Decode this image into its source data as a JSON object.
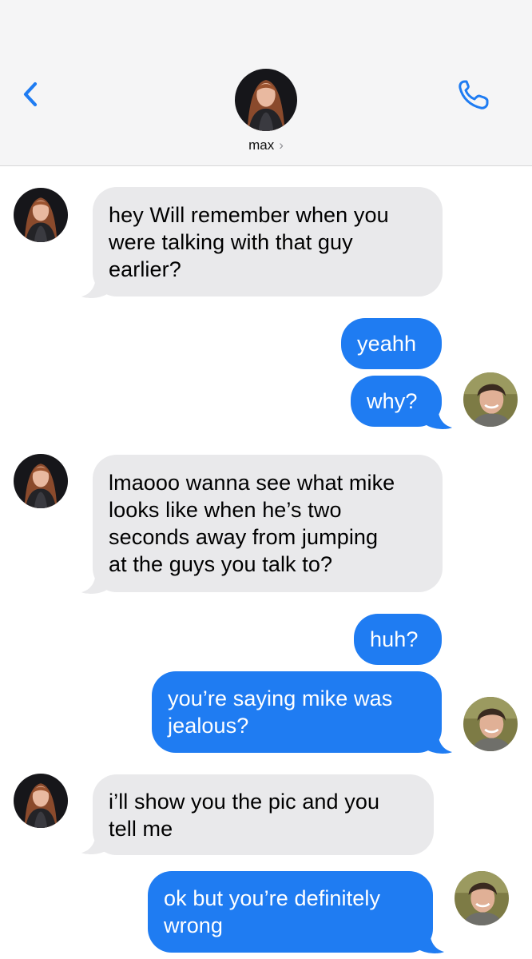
{
  "contact": {
    "name": "max",
    "chevron": "›"
  },
  "icons": {
    "back": "chevron-left-icon",
    "call": "phone-icon"
  },
  "colors": {
    "outgoing": "#1f7cf2",
    "incoming": "#e9e9eb",
    "accent": "#1f7cf2"
  },
  "messages": [
    {
      "side": "in",
      "lines": [
        "hey Will remember when you",
        "were talking with that guy",
        "earlier?"
      ]
    },
    {
      "side": "out",
      "lines": [
        "yeahh"
      ]
    },
    {
      "side": "out",
      "lines": [
        "why?"
      ]
    },
    {
      "side": "in",
      "lines": [
        "lmaooo wanna see what mike",
        "looks like when he’s two",
        "seconds away from jumping",
        "at the guys you talk to?"
      ]
    },
    {
      "side": "out",
      "lines": [
        "huh?"
      ]
    },
    {
      "side": "out",
      "lines": [
        "you’re saying mike was",
        "jealous?"
      ]
    },
    {
      "side": "in",
      "lines": [
        "i’ll show you the pic and you",
        "tell me"
      ]
    },
    {
      "side": "out",
      "lines": [
        "ok but you’re definitely",
        "wrong"
      ]
    }
  ]
}
